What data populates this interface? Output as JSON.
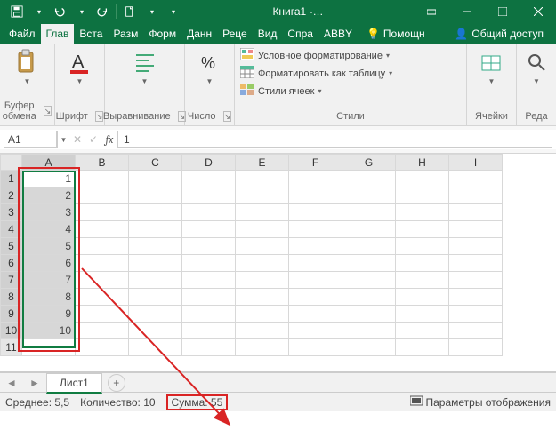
{
  "titlebar": {
    "title": "Книга1 -…",
    "qat": {
      "save": "💾",
      "undo": "↶",
      "redo": "↷",
      "new": "📄"
    },
    "win": {
      "ribbon_toggle": "▭",
      "min": "—",
      "max": "□",
      "close": "✕"
    }
  },
  "tabs": {
    "file": "Файл",
    "home": "Глав",
    "insert": "Вста",
    "layout": "Разм",
    "formulas": "Форм",
    "data": "Данн",
    "review": "Реце",
    "view": "Вид",
    "help": "Спра",
    "abbyy": "ABBY",
    "tell_me": "Помощн",
    "share": "Общий доступ"
  },
  "ribbon": {
    "clipboard": {
      "label": "Буфер обмена"
    },
    "font": {
      "label": "Шрифт"
    },
    "alignment": {
      "label": "Выравнивание"
    },
    "number": {
      "label": "Число"
    },
    "styles": {
      "label": "Стили",
      "cond_format": "Условное форматирование",
      "as_table": "Форматировать как таблицу",
      "cell_styles": "Стили ячеек"
    },
    "cells": {
      "label": "Ячейки"
    },
    "editing": {
      "label": "Реда"
    }
  },
  "formula_bar": {
    "name_box": "A1",
    "cancel": "✕",
    "enter": "✓",
    "fx": "fx",
    "formula": "1"
  },
  "grid": {
    "columns": [
      "A",
      "B",
      "C",
      "D",
      "E",
      "F",
      "G",
      "H",
      "I"
    ],
    "rows": [
      1,
      2,
      3,
      4,
      5,
      6,
      7,
      8,
      9,
      10,
      11
    ],
    "data_col_a": [
      "1",
      "2",
      "3",
      "4",
      "5",
      "6",
      "7",
      "8",
      "9",
      "10"
    ]
  },
  "sheet_tabs": {
    "prev": "◄",
    "next": "►",
    "sheet1": "Лист1",
    "add": "+"
  },
  "status": {
    "average": "Среднее: 5,5",
    "count": "Количество: 10",
    "sum": "Сумма: 55",
    "display_opts": "Параметры отображения"
  }
}
